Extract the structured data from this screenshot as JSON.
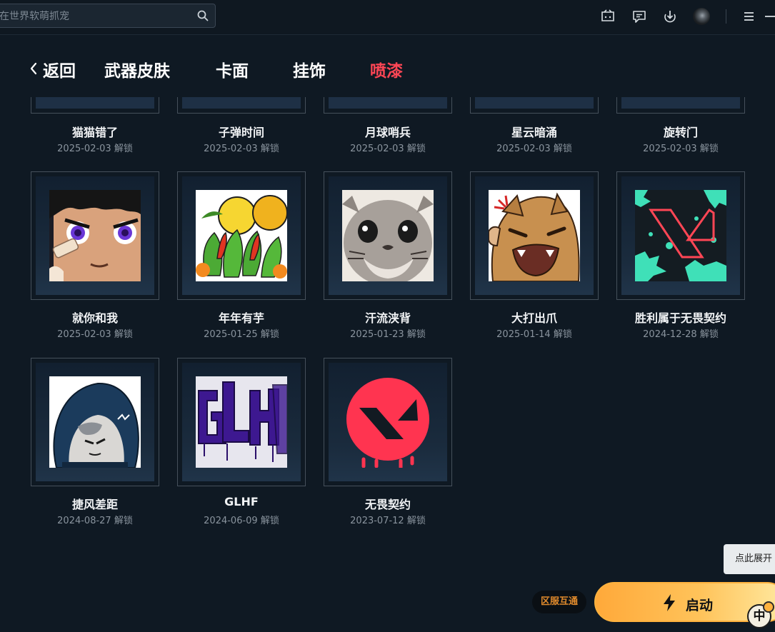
{
  "search": {
    "placeholder": "在世界软萌抓宠"
  },
  "nav": {
    "back_label": "返回",
    "tabs": [
      {
        "label": "武器皮肤"
      },
      {
        "label": "卡面"
      },
      {
        "label": "挂饰"
      },
      {
        "label": "喷漆",
        "active": true
      }
    ]
  },
  "sprays": [
    {
      "name": "猫猫错了",
      "date": "2025-02-03 解锁"
    },
    {
      "name": "子弹时间",
      "date": "2025-02-03 解锁"
    },
    {
      "name": "月球哨兵",
      "date": "2025-02-03 解锁"
    },
    {
      "name": "星云暗涌",
      "date": "2025-02-03 解锁"
    },
    {
      "name": "旋转门",
      "date": "2025-02-03 解锁"
    },
    {
      "name": "就你和我",
      "date": "2025-02-03 解锁",
      "icon": "anime-boy-bandage-icon"
    },
    {
      "name": "年年有芋",
      "date": "2025-01-25 解锁",
      "icon": "taro-vegetables-icon"
    },
    {
      "name": "汗流浃背",
      "date": "2025-01-23 解锁",
      "icon": "sweating-seal-icon"
    },
    {
      "name": "大打出爪",
      "date": "2025-01-14 解锁",
      "icon": "angry-tiger-icon"
    },
    {
      "name": "胜利属于无畏契约",
      "date": "2024-12-28 解锁",
      "icon": "valorant-v-logo-icon"
    },
    {
      "name": "捷风差距",
      "date": "2024-08-27 解锁",
      "icon": "jett-hood-icon"
    },
    {
      "name": "GLHF",
      "date": "2024-06-09 解锁",
      "icon": "glhf-graffiti-icon"
    },
    {
      "name": "无畏契约",
      "date": "2023-07-12 解锁",
      "icon": "valorant-red-circle-icon"
    }
  ],
  "tooltip": {
    "label": "点此展开"
  },
  "region": {
    "label": "区服互通"
  },
  "launch": {
    "label": "启动"
  },
  "ime": {
    "label": "中"
  },
  "colors": {
    "accent": "#ff4655",
    "launch": "#ffb23e",
    "background": "#0f1923"
  }
}
